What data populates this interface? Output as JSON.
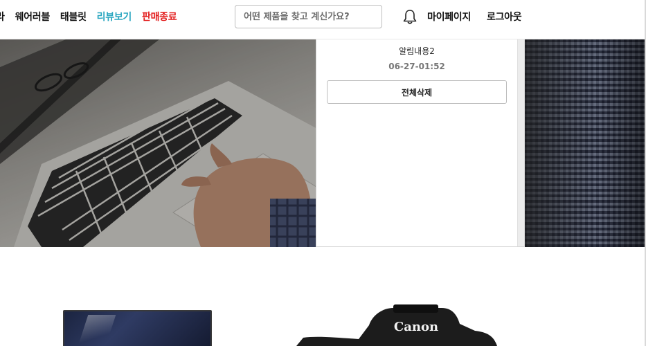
{
  "header": {
    "nav": [
      {
        "label": "라"
      },
      {
        "label": "웨어러블"
      },
      {
        "label": "태블릿"
      },
      {
        "label": "리뷰보기"
      },
      {
        "label": "판매종료"
      }
    ],
    "search_placeholder": "어떤 제품을 찾고 계신가요?",
    "bell_icon": "bell-icon",
    "mypage_label": "마이페이지",
    "logout_label": "로그아웃"
  },
  "notifications": {
    "items": [
      {
        "title": "알림내용2",
        "time": "06-27-01:52"
      }
    ],
    "delete_all_label": "전체삭제"
  },
  "products": {
    "camera_brand": "Canon"
  },
  "colors": {
    "review_link": "#2aa6c0",
    "ended_link": "#e21b1b"
  }
}
